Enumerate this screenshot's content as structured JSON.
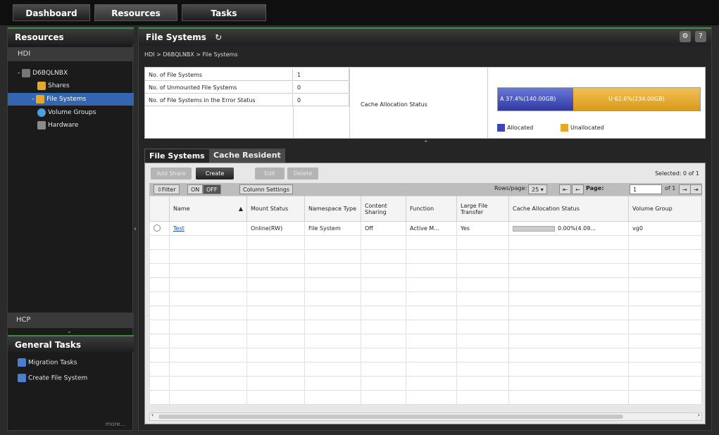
{
  "top_tabs": [
    "Dashboard",
    "Resources",
    "Tasks"
  ],
  "left": {
    "resources_header": "Resources",
    "hdi_label": "HDI",
    "tree": [
      "D6BQLNBX",
      "Shares",
      "File Systems",
      "Volume Groups",
      "Hardware"
    ],
    "hcp_label": "HCP",
    "general_tasks_header": "General Tasks",
    "general_tasks": [
      "Migration Tasks",
      "Create File System"
    ],
    "more": "more..."
  },
  "main": {
    "title": "File Systems",
    "refresh_glyph": "↻",
    "breadcrumb": "HDI > D6BQLNBX > File Systems",
    "help_glyph": "?"
  },
  "summary": {
    "rows": [
      {
        "label": "No. of File Systems",
        "value": "1"
      },
      {
        "label": "No. of Unmounted File Systems",
        "value": "0"
      },
      {
        "label": "No. of File Systems in the Error Status",
        "value": "0"
      }
    ],
    "cache_label": "Cache Allocation Status",
    "allocated_text": "A 37.4%(140.00GB)",
    "unallocated_text": "U 62.6%(234.00GB)",
    "allocated_fraction": 0.374,
    "legend_allocated": "Allocated",
    "legend_unallocated": "Unallocated",
    "allocated_color": "#3a47b5",
    "unallocated_color": "#e3a92e"
  },
  "subtabs": [
    "File Systems",
    "Cache Resident"
  ],
  "toolbar": {
    "add_share": "Add Share",
    "create": "Create",
    "edit": "Edit",
    "delete": "Delete",
    "selected": "Selected:  0  of 1",
    "filter": "⇳Filter",
    "on": "ON",
    "off": "OFF",
    "column_settings": "Column Settings",
    "rows_per_page_label": "Rows/page:",
    "rows_per_page_value": "25",
    "page_label": "Page:",
    "page_value": "1",
    "page_of": "of 1"
  },
  "table": {
    "headers": [
      "Name",
      "Mount Status",
      "Namespace Type",
      "Content Sharing",
      "Function",
      "Large File Transfer",
      "Cache Allocation Status",
      "Volume Group"
    ],
    "sort_indicator": "▲",
    "rows": [
      {
        "name": "Test",
        "mount": "Online(RW)",
        "namespace": "File System",
        "sharing": "Off",
        "function": "Active M...",
        "large": "Yes",
        "cache": "0.00%(4.09...",
        "vg": "vg0"
      }
    ]
  }
}
